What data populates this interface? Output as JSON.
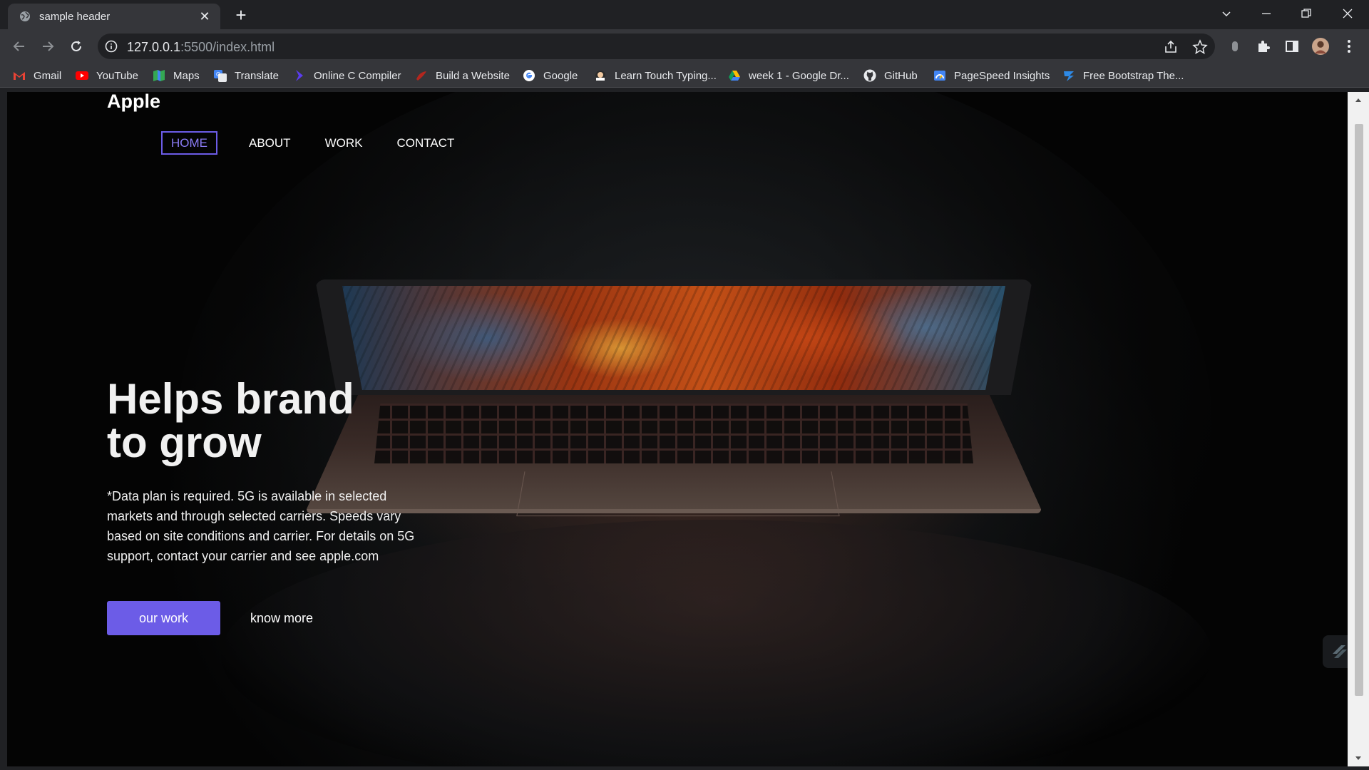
{
  "browser": {
    "tab_title": "sample header",
    "url_host": "127.0.0.1",
    "url_rest": ":5500/index.html",
    "bookmarks": [
      {
        "label": "Gmail",
        "icon": "gmail-icon"
      },
      {
        "label": "YouTube",
        "icon": "youtube-icon"
      },
      {
        "label": "Maps",
        "icon": "maps-icon"
      },
      {
        "label": "Translate",
        "icon": "translate-icon"
      },
      {
        "label": "Online C Compiler",
        "icon": "compiler-icon"
      },
      {
        "label": "Build a Website",
        "icon": "website-builder-icon"
      },
      {
        "label": "Google",
        "icon": "google-icon"
      },
      {
        "label": "Learn Touch Typing...",
        "icon": "typing-icon"
      },
      {
        "label": "week 1 - Google Dr...",
        "icon": "google-drive-icon"
      },
      {
        "label": "GitHub",
        "icon": "github-icon"
      },
      {
        "label": "PageSpeed Insights",
        "icon": "pagespeed-icon"
      },
      {
        "label": "Free Bootstrap The...",
        "icon": "bootstrap-icon"
      }
    ]
  },
  "page": {
    "logo": "Apple",
    "nav": [
      {
        "label": "HOME",
        "active": true
      },
      {
        "label": "ABOUT",
        "active": false
      },
      {
        "label": "WORK",
        "active": false
      },
      {
        "label": "CONTACT",
        "active": false
      }
    ],
    "headline": "Helps brand to grow",
    "description": "*Data plan is required. 5G is available in selected markets and through selected carriers. Speeds vary based on site conditions and carrier. For details on 5G support, contact your carrier and see apple.com",
    "primary_button": "our work",
    "secondary_link": "know more"
  },
  "colors": {
    "accent": "#6c5ce7",
    "chrome_dark": "#202124",
    "chrome_toolbar": "#35363a"
  }
}
